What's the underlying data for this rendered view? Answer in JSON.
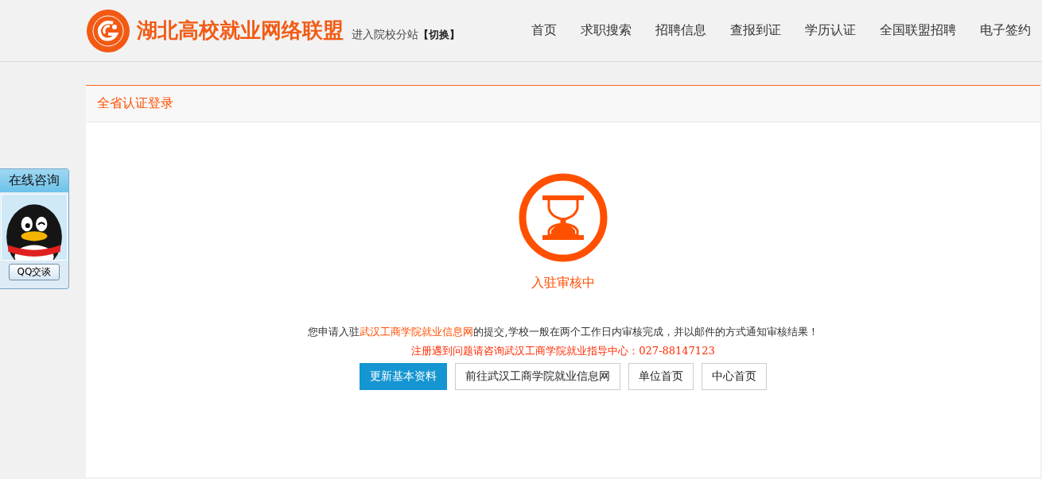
{
  "header": {
    "site_title": "湖北高校就业网络联盟",
    "branch_label": "进入院校分站",
    "switch_link": "【切换】"
  },
  "nav": [
    {
      "label": "首页"
    },
    {
      "label": "求职搜索"
    },
    {
      "label": "招聘信息"
    },
    {
      "label": "查报到证"
    },
    {
      "label": "学历认证"
    },
    {
      "label": "全国联盟招聘"
    },
    {
      "label": "电子签约"
    }
  ],
  "panel": {
    "title": "全省认证登录"
  },
  "status": {
    "kind": "pending",
    "label": "入驻审核中"
  },
  "notice": {
    "before": "您申请入驻",
    "link": "武汉工商学院就业信息网",
    "after": "的提交,学校一般在两个工作日内审核完成，并以邮件的方式通知审核结果！"
  },
  "contact": "注册遇到问题请咨询武汉工商学院就业指导中心：027-88147123",
  "buttons": [
    {
      "label": "更新基本资料",
      "primary": true
    },
    {
      "label": "前往武汉工商学院就业信息网",
      "primary": false
    },
    {
      "label": "单位首页",
      "primary": false
    },
    {
      "label": "中心首页",
      "primary": false
    }
  ],
  "consult": {
    "title": "在线咨询",
    "button": "QQ交谈"
  }
}
